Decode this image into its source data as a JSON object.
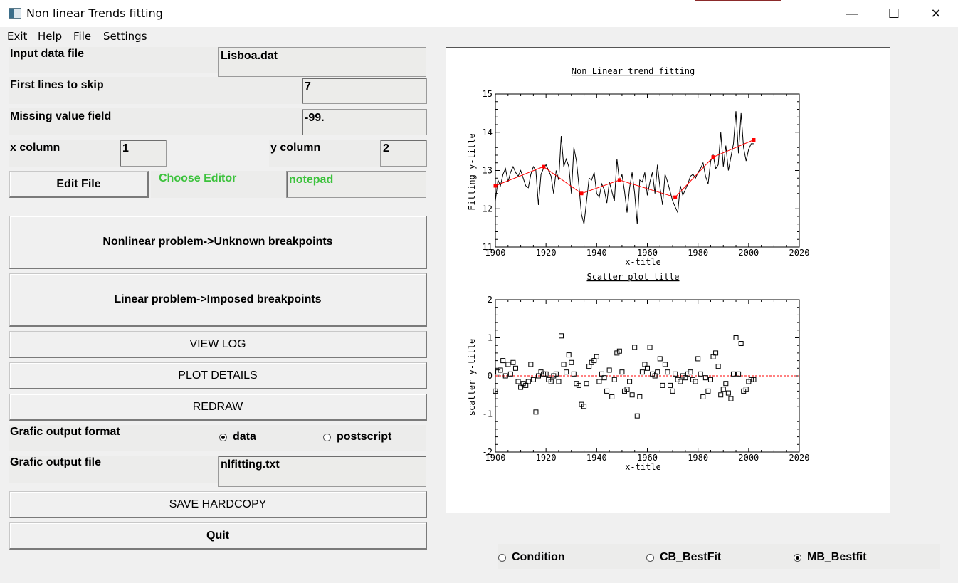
{
  "window": {
    "title": "Non linear Trends fitting",
    "minimize": "—",
    "maximize": "☐",
    "close": "✕"
  },
  "menu": [
    "Exit",
    "Help",
    "File",
    "Settings"
  ],
  "form": {
    "input_file_label": "Input data file",
    "input_file_value": "Lisboa.dat",
    "skip_label": "First lines to skip",
    "skip_value": "7",
    "missing_label": "Missing value field",
    "missing_value": "-99.",
    "xcol_label": "x column",
    "xcol_value": "1",
    "ycol_label": "y column",
    "ycol_value": "2",
    "edit_file": "Edit File",
    "choose_editor_label": "Choose Editor",
    "editor_value": "notepad",
    "nonlinear_button": "Nonlinear problem->Unknown breakpoints",
    "linear_button": "Linear problem->Imposed breakpoints",
    "view_log": "VIEW LOG",
    "plot_details": "PLOT  DETAILS",
    "redraw": "REDRAW",
    "grafic_format_label": "Grafic output format",
    "format_options": [
      "data",
      "postscript"
    ],
    "format_selected": "data",
    "grafic_file_label": "Grafic output file",
    "grafic_file_value": "nlfitting.txt",
    "save_hardcopy": "SAVE HARDCOPY",
    "quit": "Quit"
  },
  "bottom_options": {
    "items": [
      "Condition",
      "CB_BestFit",
      "MB_Bestfit"
    ],
    "selected": "MB_Bestfit"
  },
  "chart_data": [
    {
      "type": "line",
      "title": "Non Linear trend fitting",
      "xlabel": "x-title",
      "ylabel": "Fitting y-title",
      "xlim": [
        1900,
        2020
      ],
      "ylim": [
        11,
        15
      ],
      "xticks": [
        1900,
        1920,
        1940,
        1960,
        1980,
        2000,
        2020
      ],
      "yticks": [
        11,
        12,
        13,
        14,
        15
      ],
      "series": [
        {
          "role": "data",
          "color": "#000000",
          "x": [
            1900,
            1901,
            1902,
            1903,
            1904,
            1905,
            1906,
            1907,
            1908,
            1909,
            1910,
            1911,
            1912,
            1913,
            1914,
            1915,
            1916,
            1917,
            1918,
            1919,
            1920,
            1921,
            1922,
            1923,
            1924,
            1925,
            1926,
            1927,
            1928,
            1929,
            1930,
            1931,
            1932,
            1933,
            1934,
            1935,
            1936,
            1937,
            1938,
            1939,
            1940,
            1941,
            1942,
            1943,
            1944,
            1945,
            1946,
            1947,
            1948,
            1949,
            1950,
            1951,
            1952,
            1953,
            1954,
            1955,
            1956,
            1957,
            1958,
            1959,
            1960,
            1961,
            1962,
            1963,
            1964,
            1965,
            1966,
            1967,
            1968,
            1969,
            1970,
            1971,
            1972,
            1973,
            1974,
            1975,
            1976,
            1977,
            1978,
            1979,
            1980,
            1981,
            1982,
            1983,
            1984,
            1985,
            1986,
            1987,
            1988,
            1989,
            1990,
            1991,
            1992,
            1993,
            1994,
            1995,
            1996,
            1997,
            1998,
            1999,
            2000,
            2001,
            2002
          ],
          "y": [
            12.2,
            12.75,
            12.6,
            12.9,
            13.05,
            12.7,
            12.95,
            13.1,
            12.95,
            12.85,
            13.0,
            12.8,
            12.6,
            12.55,
            12.9,
            13.1,
            13.0,
            12.1,
            12.9,
            13.05,
            13.15,
            13.0,
            12.85,
            12.4,
            13.0,
            12.75,
            13.9,
            13.1,
            13.3,
            13.1,
            12.4,
            13.6,
            13.25,
            12.6,
            11.85,
            11.6,
            12.2,
            12.8,
            12.75,
            12.95,
            12.4,
            12.3,
            12.65,
            12.5,
            12.15,
            12.7,
            12.45,
            12.2,
            13.3,
            12.7,
            12.9,
            12.45,
            11.9,
            12.55,
            12.95,
            12.4,
            11.6,
            12.75,
            12.7,
            12.95,
            12.35,
            12.7,
            12.95,
            12.4,
            13.15,
            12.55,
            12.1,
            12.9,
            12.7,
            12.45,
            12.2,
            12.05,
            11.9,
            12.6,
            12.35,
            12.5,
            12.65,
            12.85,
            12.9,
            12.8,
            12.95,
            13.05,
            13.2,
            12.85,
            12.65,
            13.25,
            13.4,
            13.05,
            13.15,
            14.0,
            13.1,
            13.65,
            13.0,
            13.35,
            13.7,
            14.55,
            13.45,
            14.5,
            13.6,
            13.25,
            13.55,
            13.7,
            13.7
          ]
        },
        {
          "role": "trend",
          "color": "#ff0000",
          "x": [
            1900,
            1919,
            1934,
            1949,
            1971,
            1986,
            2002
          ],
          "y": [
            12.6,
            13.1,
            12.4,
            12.75,
            12.3,
            13.35,
            13.8
          ]
        }
      ]
    },
    {
      "type": "scatter",
      "title": "Scatter plot title",
      "xlabel": "x-title",
      "ylabel": "scatter y-title",
      "xlim": [
        1900,
        2020
      ],
      "ylim": [
        -2,
        2
      ],
      "xticks": [
        1900,
        1920,
        1940,
        1960,
        1980,
        2000,
        2020
      ],
      "yticks": [
        -2,
        -1,
        0,
        1,
        2
      ],
      "reference_line": {
        "y": 0,
        "color": "#ff0000",
        "style": "dashed"
      },
      "points": {
        "x": [
          1900,
          1901,
          1902,
          1903,
          1904,
          1905,
          1906,
          1907,
          1908,
          1909,
          1910,
          1911,
          1912,
          1913,
          1914,
          1915,
          1916,
          1917,
          1918,
          1919,
          1920,
          1921,
          1922,
          1923,
          1924,
          1925,
          1926,
          1927,
          1928,
          1929,
          1930,
          1931,
          1932,
          1933,
          1934,
          1935,
          1936,
          1937,
          1938,
          1939,
          1940,
          1941,
          1942,
          1943,
          1944,
          1945,
          1946,
          1947,
          1948,
          1949,
          1950,
          1951,
          1952,
          1953,
          1954,
          1955,
          1956,
          1957,
          1958,
          1959,
          1960,
          1961,
          1962,
          1963,
          1964,
          1965,
          1966,
          1967,
          1968,
          1969,
          1970,
          1971,
          1972,
          1973,
          1974,
          1975,
          1976,
          1977,
          1978,
          1979,
          1980,
          1981,
          1982,
          1983,
          1984,
          1985,
          1986,
          1987,
          1988,
          1989,
          1990,
          1991,
          1992,
          1993,
          1994,
          1995,
          1996,
          1997,
          1998,
          1999,
          2000,
          2001,
          2002
        ],
        "y": [
          -0.4,
          0.1,
          0.15,
          0.4,
          0.0,
          0.3,
          0.05,
          0.35,
          0.2,
          -0.15,
          -0.3,
          -0.2,
          -0.25,
          -0.15,
          0.3,
          -0.1,
          -0.95,
          0.0,
          0.1,
          0.05,
          0.05,
          -0.1,
          -0.15,
          0.0,
          0.05,
          -0.15,
          1.05,
          0.3,
          0.1,
          0.55,
          0.35,
          0.05,
          -0.2,
          -0.25,
          -0.75,
          -0.8,
          -0.2,
          0.25,
          0.35,
          0.4,
          0.5,
          -0.15,
          0.05,
          -0.05,
          -0.4,
          0.15,
          -0.55,
          -0.1,
          0.6,
          0.65,
          0.1,
          -0.4,
          -0.35,
          -0.15,
          -0.5,
          0.75,
          -1.05,
          -0.55,
          0.1,
          0.3,
          0.2,
          0.75,
          0.05,
          0.0,
          0.1,
          0.45,
          -0.25,
          0.3,
          0.1,
          -0.25,
          -0.4,
          0.05,
          -0.1,
          -0.15,
          0.0,
          -0.05,
          0.05,
          0.1,
          -0.1,
          -0.15,
          0.45,
          0.05,
          -0.55,
          -0.05,
          -0.4,
          -0.1,
          0.5,
          0.6,
          0.25,
          -0.5,
          -0.35,
          -0.2,
          -0.45,
          -0.6,
          0.05,
          1.0,
          0.05,
          0.85,
          -0.4,
          -0.35,
          -0.15,
          -0.1,
          -0.1
        ]
      }
    }
  ]
}
